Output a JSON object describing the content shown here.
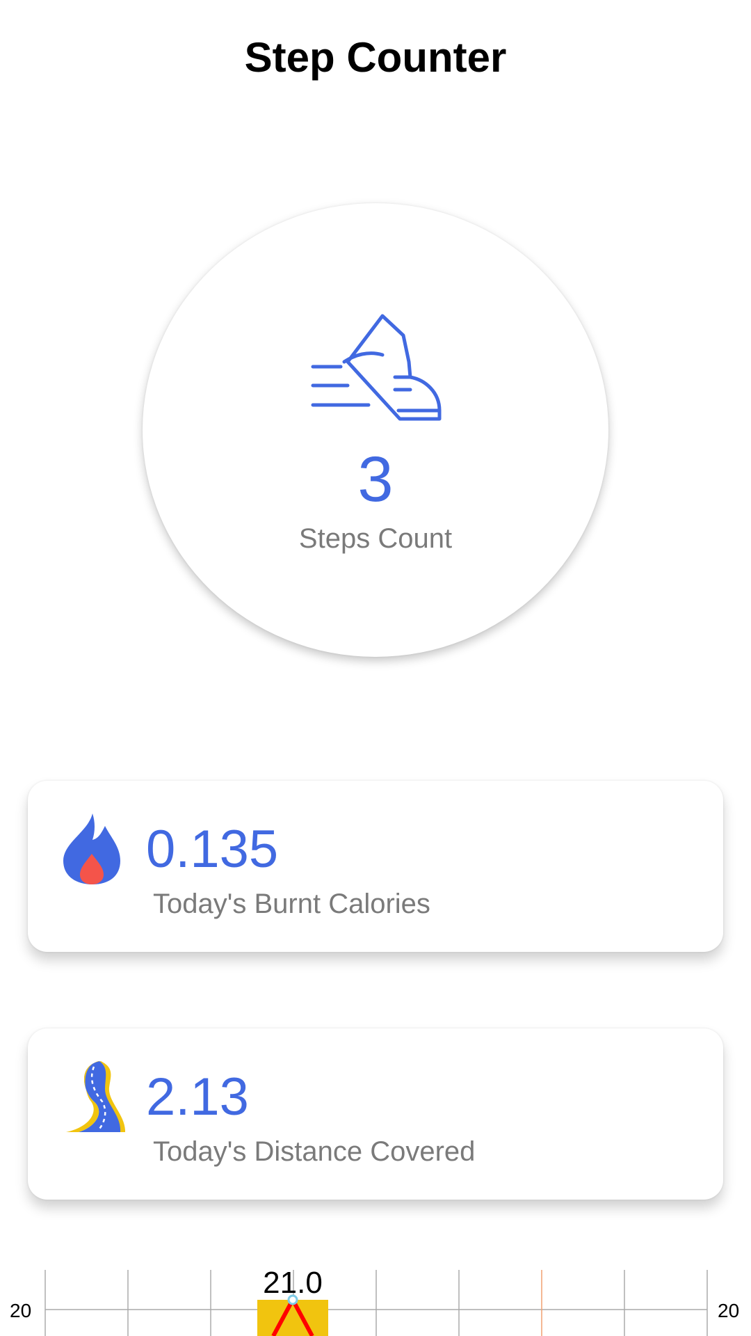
{
  "app": {
    "title": "Step Counter"
  },
  "steps": {
    "value": "3",
    "label": "Steps Count",
    "icon": "walking-shoe-icon"
  },
  "calories_card": {
    "value": "0.135",
    "label": "Today's Burnt Calories",
    "icon": "flame-icon"
  },
  "distance_card": {
    "value": "2.13",
    "label": "Today's Distance Covered",
    "icon": "road-icon"
  },
  "colors": {
    "accent": "#4169e1",
    "label_gray": "#7a7a7a",
    "bar": "#f1c40f",
    "line": "#ff0000"
  },
  "chart_data": {
    "type": "bar",
    "left_axis_tick": "20",
    "right_axis_tick": "20",
    "bars": [
      {
        "value": 21.0,
        "label": "21.0"
      }
    ],
    "line_value": 21.0,
    "grid": true
  }
}
